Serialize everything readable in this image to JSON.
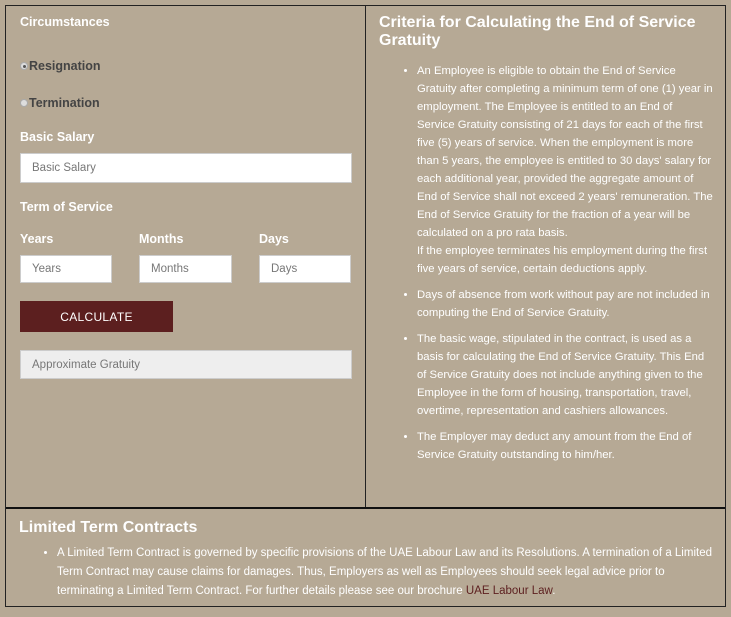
{
  "form": {
    "circumstances_label": "Circumstances",
    "options": [
      {
        "label": "Resignation",
        "selected": true
      },
      {
        "label": "Termination",
        "selected": false
      }
    ],
    "salary_label": "Basic Salary",
    "salary_placeholder": "Basic Salary",
    "salary_value": "",
    "term_label": "Term of Service",
    "years_label": "Years",
    "years_placeholder": "Years",
    "months_label": "Months",
    "months_placeholder": "Months",
    "days_label": "Days",
    "days_placeholder": "Days",
    "calculate_label": "CALCULATE",
    "result_placeholder": "Approximate Gratuity"
  },
  "criteria": {
    "title": "Criteria for Calculating the End of Service Gratuity",
    "items": [
      "An Employee is eligible to obtain the End of Service Gratuity after completing a minimum term of one (1) year in employment. The Employee is entitled to an End of Service Gratuity consisting of 21 days for each of the first five (5) years of service. When the employment is more than 5 years, the employee is entitled to 30 days' salary for each additional year, provided the aggregate amount of End of Service shall not exceed 2 years' remuneration. The End of Service Gratuity for the fraction of a year will be calculated on a pro rata basis.",
      "Days of absence from work without pay are not included in computing the End of Service Gratuity.",
      "The basic wage, stipulated in the contract, is used as a basis for calculating the End of Service Gratuity. This End of Service Gratuity does not include anything given to the Employee in the form of housing, transportation, travel, overtime, representation and cashiers allowances.",
      "The Employer may deduct any amount from the End of Service Gratuity outstanding to him/her."
    ],
    "item0_extra": "If the employee terminates his employment during the first five years of service, certain deductions apply."
  },
  "limited": {
    "title": "Limited Term Contracts",
    "text": "A Limited Term Contract is governed by specific provisions of the UAE Labour Law and its Resolutions. A termination of a Limited Term Contract may cause claims for damages. Thus, Employers as well as Employees should seek legal advice prior to terminating a Limited Term Contract. For further details please see our brochure ",
    "link": "UAE Labour Law",
    "link_color": "#5c1f1f"
  }
}
